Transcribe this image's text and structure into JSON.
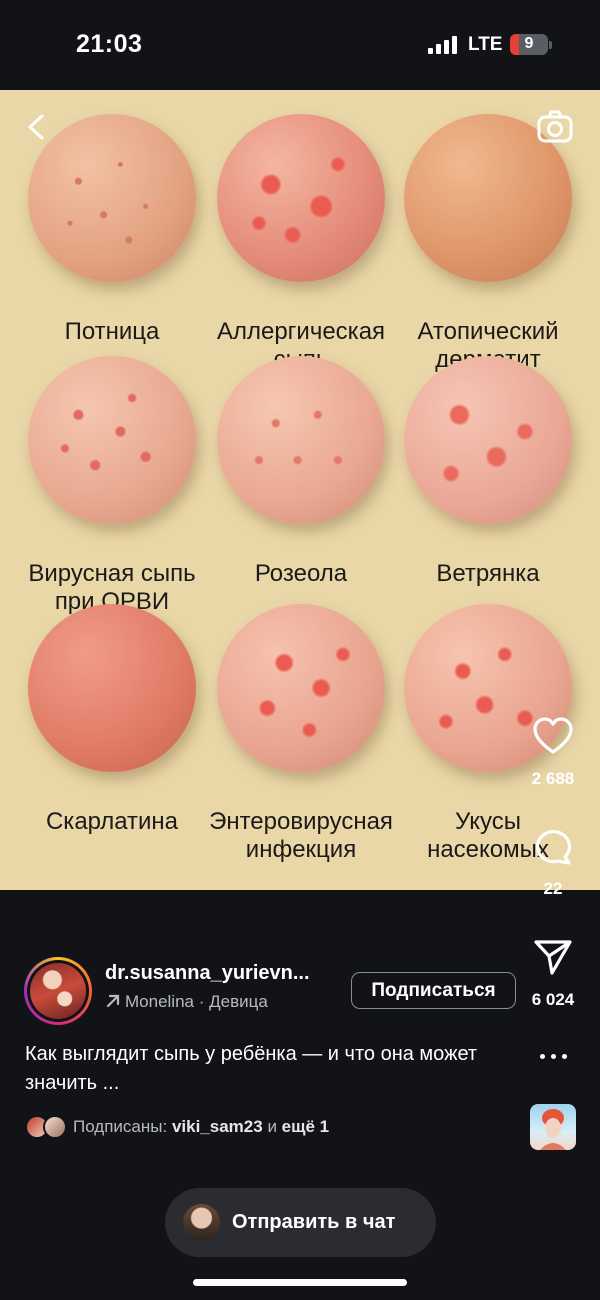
{
  "status_bar": {
    "time": "21:03",
    "network": "LTE",
    "battery": "9"
  },
  "post": {
    "tiles": [
      {
        "label": "Потница"
      },
      {
        "label": "Аллергическая\nсыпь"
      },
      {
        "label": "Атопический\nдерматит"
      },
      {
        "label": "Вирусная сыпь\nпри ОРВИ"
      },
      {
        "label": "Розеола"
      },
      {
        "label": "Ветрянка"
      },
      {
        "label": "Скарлатина"
      },
      {
        "label": "Энтеровирусная\nинфекция"
      },
      {
        "label": "Укусы\nнасекомых"
      }
    ]
  },
  "actions": {
    "likes": "2 688",
    "comments": "22",
    "shares": "6 024"
  },
  "author": {
    "username": "dr.susanna_yurievn...",
    "music": "Monelina · Девица",
    "follow_label": "Подписаться"
  },
  "caption": "Как выглядит сыпь у ребёнка — и что она может значить ...",
  "followers": {
    "prefix": "Подписаны:",
    "user": "viki_sam23",
    "joiner": "и",
    "more": "ещё 1"
  },
  "chat": {
    "label": "Отправить в чат"
  },
  "colors": {
    "background": "#111317",
    "image_bg": "#ead7a8",
    "pill": "#2a2c31"
  },
  "icons": [
    "back-icon",
    "camera-icon",
    "heart-icon",
    "comment-icon",
    "send-icon",
    "more-icon",
    "music-arrow-icon"
  ]
}
